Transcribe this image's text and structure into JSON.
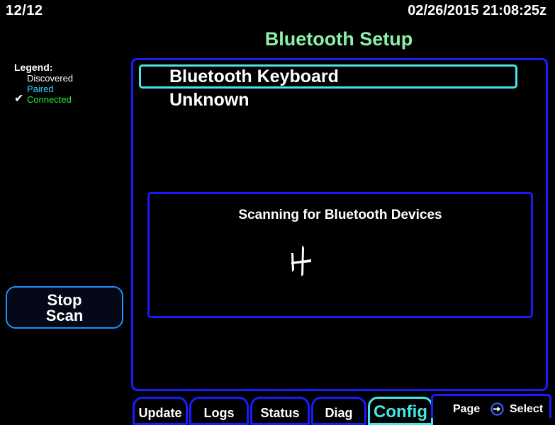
{
  "header": {
    "page_indicator": "12/12",
    "datetime": "02/26/2015 21:08:25z",
    "title": "Bluetooth Setup"
  },
  "legend": {
    "title": "Legend:",
    "discovered": "Discovered",
    "paired": "Paired",
    "connected": "Connected",
    "colors": {
      "discovered": "#ffffff",
      "paired": "#33d6ff",
      "connected": "#25ec3a"
    }
  },
  "devices": [
    {
      "name": "Bluetooth Keyboard",
      "selected": true
    },
    {
      "name": "Unknown",
      "selected": false
    }
  ],
  "scan": {
    "message": "Scanning for Bluetooth Devices",
    "icon": "airplane-icon"
  },
  "actions": {
    "stop_scan_line1": "Stop",
    "stop_scan_line2": "Scan"
  },
  "tabs": [
    {
      "label": "Update",
      "active": false
    },
    {
      "label": "Logs",
      "active": false
    },
    {
      "label": "Status",
      "active": false
    },
    {
      "label": "Diag",
      "active": false
    },
    {
      "label": "Config",
      "active": true
    }
  ],
  "footer": {
    "page_label": "Page",
    "select_label": "Select",
    "select_icon": "knob-select-icon"
  },
  "colors": {
    "frame_blue": "#1a1aff",
    "highlight_cyan": "#45e7e8",
    "title_green": "#8cf0a8"
  }
}
